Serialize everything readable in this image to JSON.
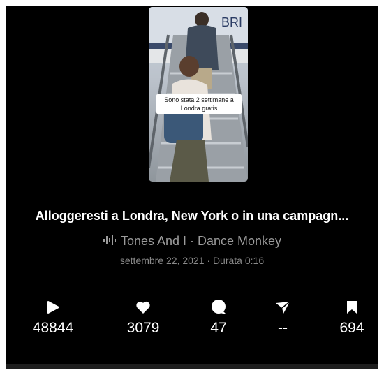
{
  "video": {
    "caption": "Sono stata 2 settimane a Londra gratis",
    "plane_lettering": "BRI"
  },
  "title": "Alloggeresti a Londra, New York o in una campagn...",
  "sound": {
    "icon": "waveform-icon",
    "text": "Tones And I · Dance Monkey"
  },
  "meta": "settembre 22, 2021 · Durata 0:16",
  "stats": {
    "plays": {
      "icon": "play-icon",
      "value": "48844"
    },
    "likes": {
      "icon": "heart-icon",
      "value": "3079"
    },
    "comments": {
      "icon": "comment-icon",
      "value": "47"
    },
    "shares": {
      "icon": "share-icon",
      "value": "--"
    },
    "saves": {
      "icon": "bookmark-icon",
      "value": "694"
    }
  },
  "colors": {
    "background": "#000000",
    "text": "#ffffff",
    "muted": "#9c9c9c"
  }
}
